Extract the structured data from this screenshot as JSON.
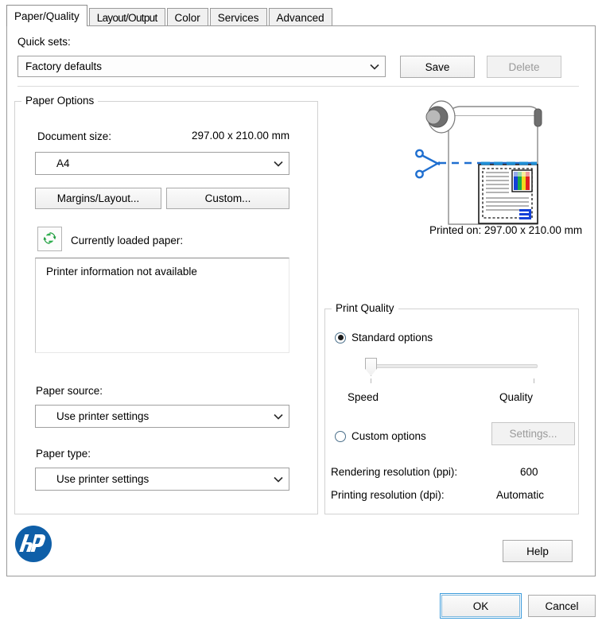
{
  "tabs": [
    {
      "label": "Paper/Quality",
      "active": true
    },
    {
      "label": "Layout/Output",
      "active": false
    },
    {
      "label": "Color",
      "active": false
    },
    {
      "label": "Services",
      "active": false
    },
    {
      "label": "Advanced",
      "active": false
    }
  ],
  "quick_sets": {
    "label": "Quick sets:",
    "value": "Factory defaults",
    "save_label": "Save",
    "delete_label": "Delete"
  },
  "paper_options": {
    "legend": "Paper Options",
    "document_size_label": "Document size:",
    "document_size_dimensions": "297.00 x 210.00 mm",
    "document_size_value": "A4",
    "margins_button": "Margins/Layout...",
    "custom_button": "Custom...",
    "refresh_icon": "refresh-icon",
    "currently_loaded_label": "Currently loaded paper:",
    "currently_loaded_text": "Printer information not available",
    "paper_source_label": "Paper source:",
    "paper_source_value": "Use printer settings",
    "paper_type_label": "Paper type:",
    "paper_type_value": "Use printer settings"
  },
  "print_quality": {
    "legend": "Print Quality",
    "standard_options_label": "Standard options",
    "standard_selected": true,
    "slider_speed_label": "Speed",
    "slider_quality_label": "Quality",
    "slider_position_percent": 0,
    "custom_options_label": "Custom options",
    "custom_selected": false,
    "settings_button": "Settings...",
    "settings_disabled": true,
    "rendering_resolution_label": "Rendering resolution (ppi):",
    "rendering_resolution_value": "600",
    "printing_resolution_label": "Printing resolution (dpi):",
    "printing_resolution_value": "Automatic"
  },
  "preview": {
    "printed_on": "Printed on: 297.00 x 210.00 mm",
    "scissors_icon": "scissors-icon",
    "cut_line_color": "#1f6fd0"
  },
  "branding": {
    "logo": "hp-logo",
    "logo_color": "#0F5FA8"
  },
  "footer": {
    "help_label": "Help",
    "ok_label": "OK",
    "cancel_label": "Cancel"
  },
  "colors": {
    "accent_blue": "#1f6fd0",
    "refresh_green": "#1c9c3c",
    "focus_blue": "#3c9bdb",
    "hp_blue": "#0F5FA8"
  }
}
